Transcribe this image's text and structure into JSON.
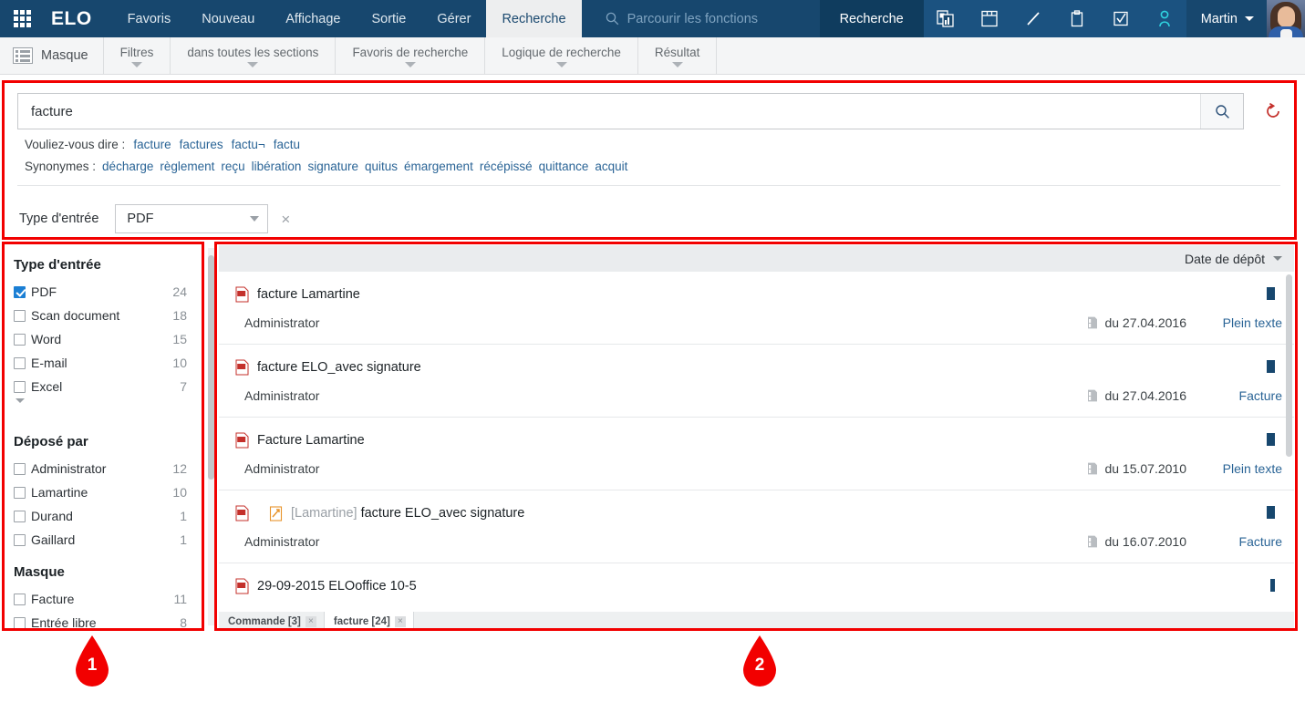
{
  "topbar": {
    "brand": "ELO",
    "tabs": [
      {
        "label": "Favoris",
        "active": false
      },
      {
        "label": "Nouveau",
        "active": false
      },
      {
        "label": "Affichage",
        "active": false
      },
      {
        "label": "Sortie",
        "active": false
      },
      {
        "label": "Gérer",
        "active": false
      },
      {
        "label": "Recherche",
        "active": true
      }
    ],
    "function_search_placeholder": "Parcourir les fonctions",
    "command_search_label": "Recherche",
    "icons": [
      "documents-icon",
      "window-layout-icon",
      "pen-icon",
      "clipboard-icon",
      "checkbox-task-icon",
      "user-profile-icon"
    ],
    "user_name": "Martin",
    "user_caret": "chevron-down-icon",
    "waffle": "app-grid-icon"
  },
  "ribbon": {
    "mask_label": "Masque",
    "items": [
      {
        "label": "Filtres"
      },
      {
        "label": "dans toutes les sections"
      },
      {
        "label": "Favoris de recherche"
      },
      {
        "label": "Logique de recherche"
      },
      {
        "label": "Résultat"
      }
    ]
  },
  "search": {
    "value": "facture",
    "placeholder": "",
    "go_icon": "search-icon",
    "reset_icon": "reset-icon",
    "did_you_mean_label": "Vouliez-vous dire :",
    "did_you_mean": [
      "facture",
      "factures",
      "factu¬",
      "factu"
    ],
    "synonyms_label": "Synonymes :",
    "synonyms": [
      "décharge",
      "règlement",
      "reçu",
      "libération",
      "signature",
      "quitus",
      "émargement",
      "récépissé",
      "quittance",
      "acquit"
    ],
    "filter_label": "Type d'entrée",
    "filter_value": "PDF",
    "filter_clear": "×"
  },
  "facets": [
    {
      "title": "Type d'entrée",
      "has_more": true,
      "items": [
        {
          "label": "PDF",
          "count": "24",
          "checked": true
        },
        {
          "label": "Scan document",
          "count": "18",
          "checked": false
        },
        {
          "label": "Word",
          "count": "15",
          "checked": false
        },
        {
          "label": "E-mail",
          "count": "10",
          "checked": false
        },
        {
          "label": "Excel",
          "count": "7",
          "checked": false
        }
      ]
    },
    {
      "title": "Déposé par",
      "has_more": false,
      "items": [
        {
          "label": "Administrator",
          "count": "12",
          "checked": false
        },
        {
          "label": "Lamartine",
          "count": "10",
          "checked": false
        },
        {
          "label": "Durand",
          "count": "1",
          "checked": false
        },
        {
          "label": "Gaillard",
          "count": "1",
          "checked": false
        }
      ]
    },
    {
      "title": "Masque",
      "has_more": false,
      "items": [
        {
          "label": "Facture",
          "count": "11",
          "checked": false
        },
        {
          "label": "Entrée libre",
          "count": "8",
          "checked": false
        }
      ]
    }
  ],
  "results": {
    "sort_label": "Date de dépôt",
    "sort_caret": "chevron-down-icon",
    "rows": [
      {
        "icon": "pdf-icon",
        "signature_icon": false,
        "prefix": "",
        "title": "facture Lamartine",
        "owner": "Administrator",
        "date": "du 27.04.2016",
        "tag": "Plein texte",
        "flag": true,
        "flag_thin": false
      },
      {
        "icon": "pdf-icon",
        "signature_icon": false,
        "prefix": "",
        "title": "facture ELO_avec signature",
        "owner": "Administrator",
        "date": "du 27.04.2016",
        "tag": "Facture",
        "flag": true,
        "flag_thin": false
      },
      {
        "icon": "pdf-icon",
        "signature_icon": false,
        "prefix": "",
        "title": "Facture Lamartine",
        "owner": "Administrator",
        "date": "du 15.07.2010",
        "tag": "Plein texte",
        "flag": true,
        "flag_thin": false
      },
      {
        "icon": "pdf-icon",
        "signature_icon": true,
        "prefix": "[Lamartine]",
        "title": "facture ELO_avec signature",
        "owner": "Administrator",
        "date": "du 16.07.2010",
        "tag": "Facture",
        "flag": true,
        "flag_thin": false
      },
      {
        "icon": "pdf-icon",
        "signature_icon": false,
        "prefix": "",
        "title": "29-09-2015 ELOoffice 10-5",
        "owner": "",
        "date": "",
        "tag": "",
        "flag": true,
        "flag_thin": true
      }
    ]
  },
  "tabstrip": [
    {
      "label": "Commande [3]",
      "active": false,
      "close": "×"
    },
    {
      "label": "facture [24]",
      "active": true,
      "close": "×"
    }
  ],
  "annotations": [
    {
      "number": "1"
    },
    {
      "number": "2"
    }
  ],
  "colors": {
    "navy": "#17476e",
    "accent_blue": "#2a6496",
    "annotation_red": "#f20000",
    "checkbox_blue": "#1b7fd4"
  }
}
